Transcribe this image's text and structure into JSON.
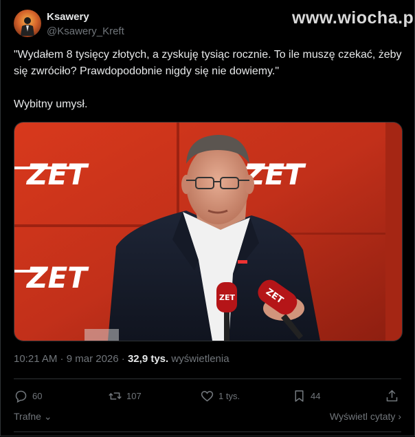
{
  "author": {
    "name": "Ksawery",
    "handle": "@Ksawery_Kreft"
  },
  "watermark": "www.wiocha.pl",
  "tweet": {
    "line1": "\"Wydałem 8 tysięcy  złotych, a zyskuję tysiąc rocznie. To ile muszę czekać, żeby się zwróciło? Prawdopodobnie nigdy się nie dowiemy.\"",
    "line2": "Wybitny umysł."
  },
  "media": {
    "logo_text": "ZET",
    "mic_text": "ZET"
  },
  "meta": {
    "time": "10:21 AM",
    "separator1": " · ",
    "date": "9 mar 2026",
    "separator2": " · ",
    "views_count": "32,9 tys.",
    "views_label": " wyświetlenia"
  },
  "actions": {
    "replies": "60",
    "reposts": "107",
    "likes": "1 tys.",
    "bookmarks": "44"
  },
  "footer": {
    "sort_label": "Trafne",
    "quotes_label": "Wyświetl cytaty"
  },
  "icons": [
    "reply-icon",
    "repost-icon",
    "like-icon",
    "bookmark-icon",
    "share-icon",
    "chevron-down-icon",
    "chevron-right-icon"
  ],
  "colors": {
    "background": "#000000",
    "text": "#e7e9ea",
    "muted": "#71767b",
    "border": "#2f3336",
    "studio_red": "#c8321c"
  }
}
